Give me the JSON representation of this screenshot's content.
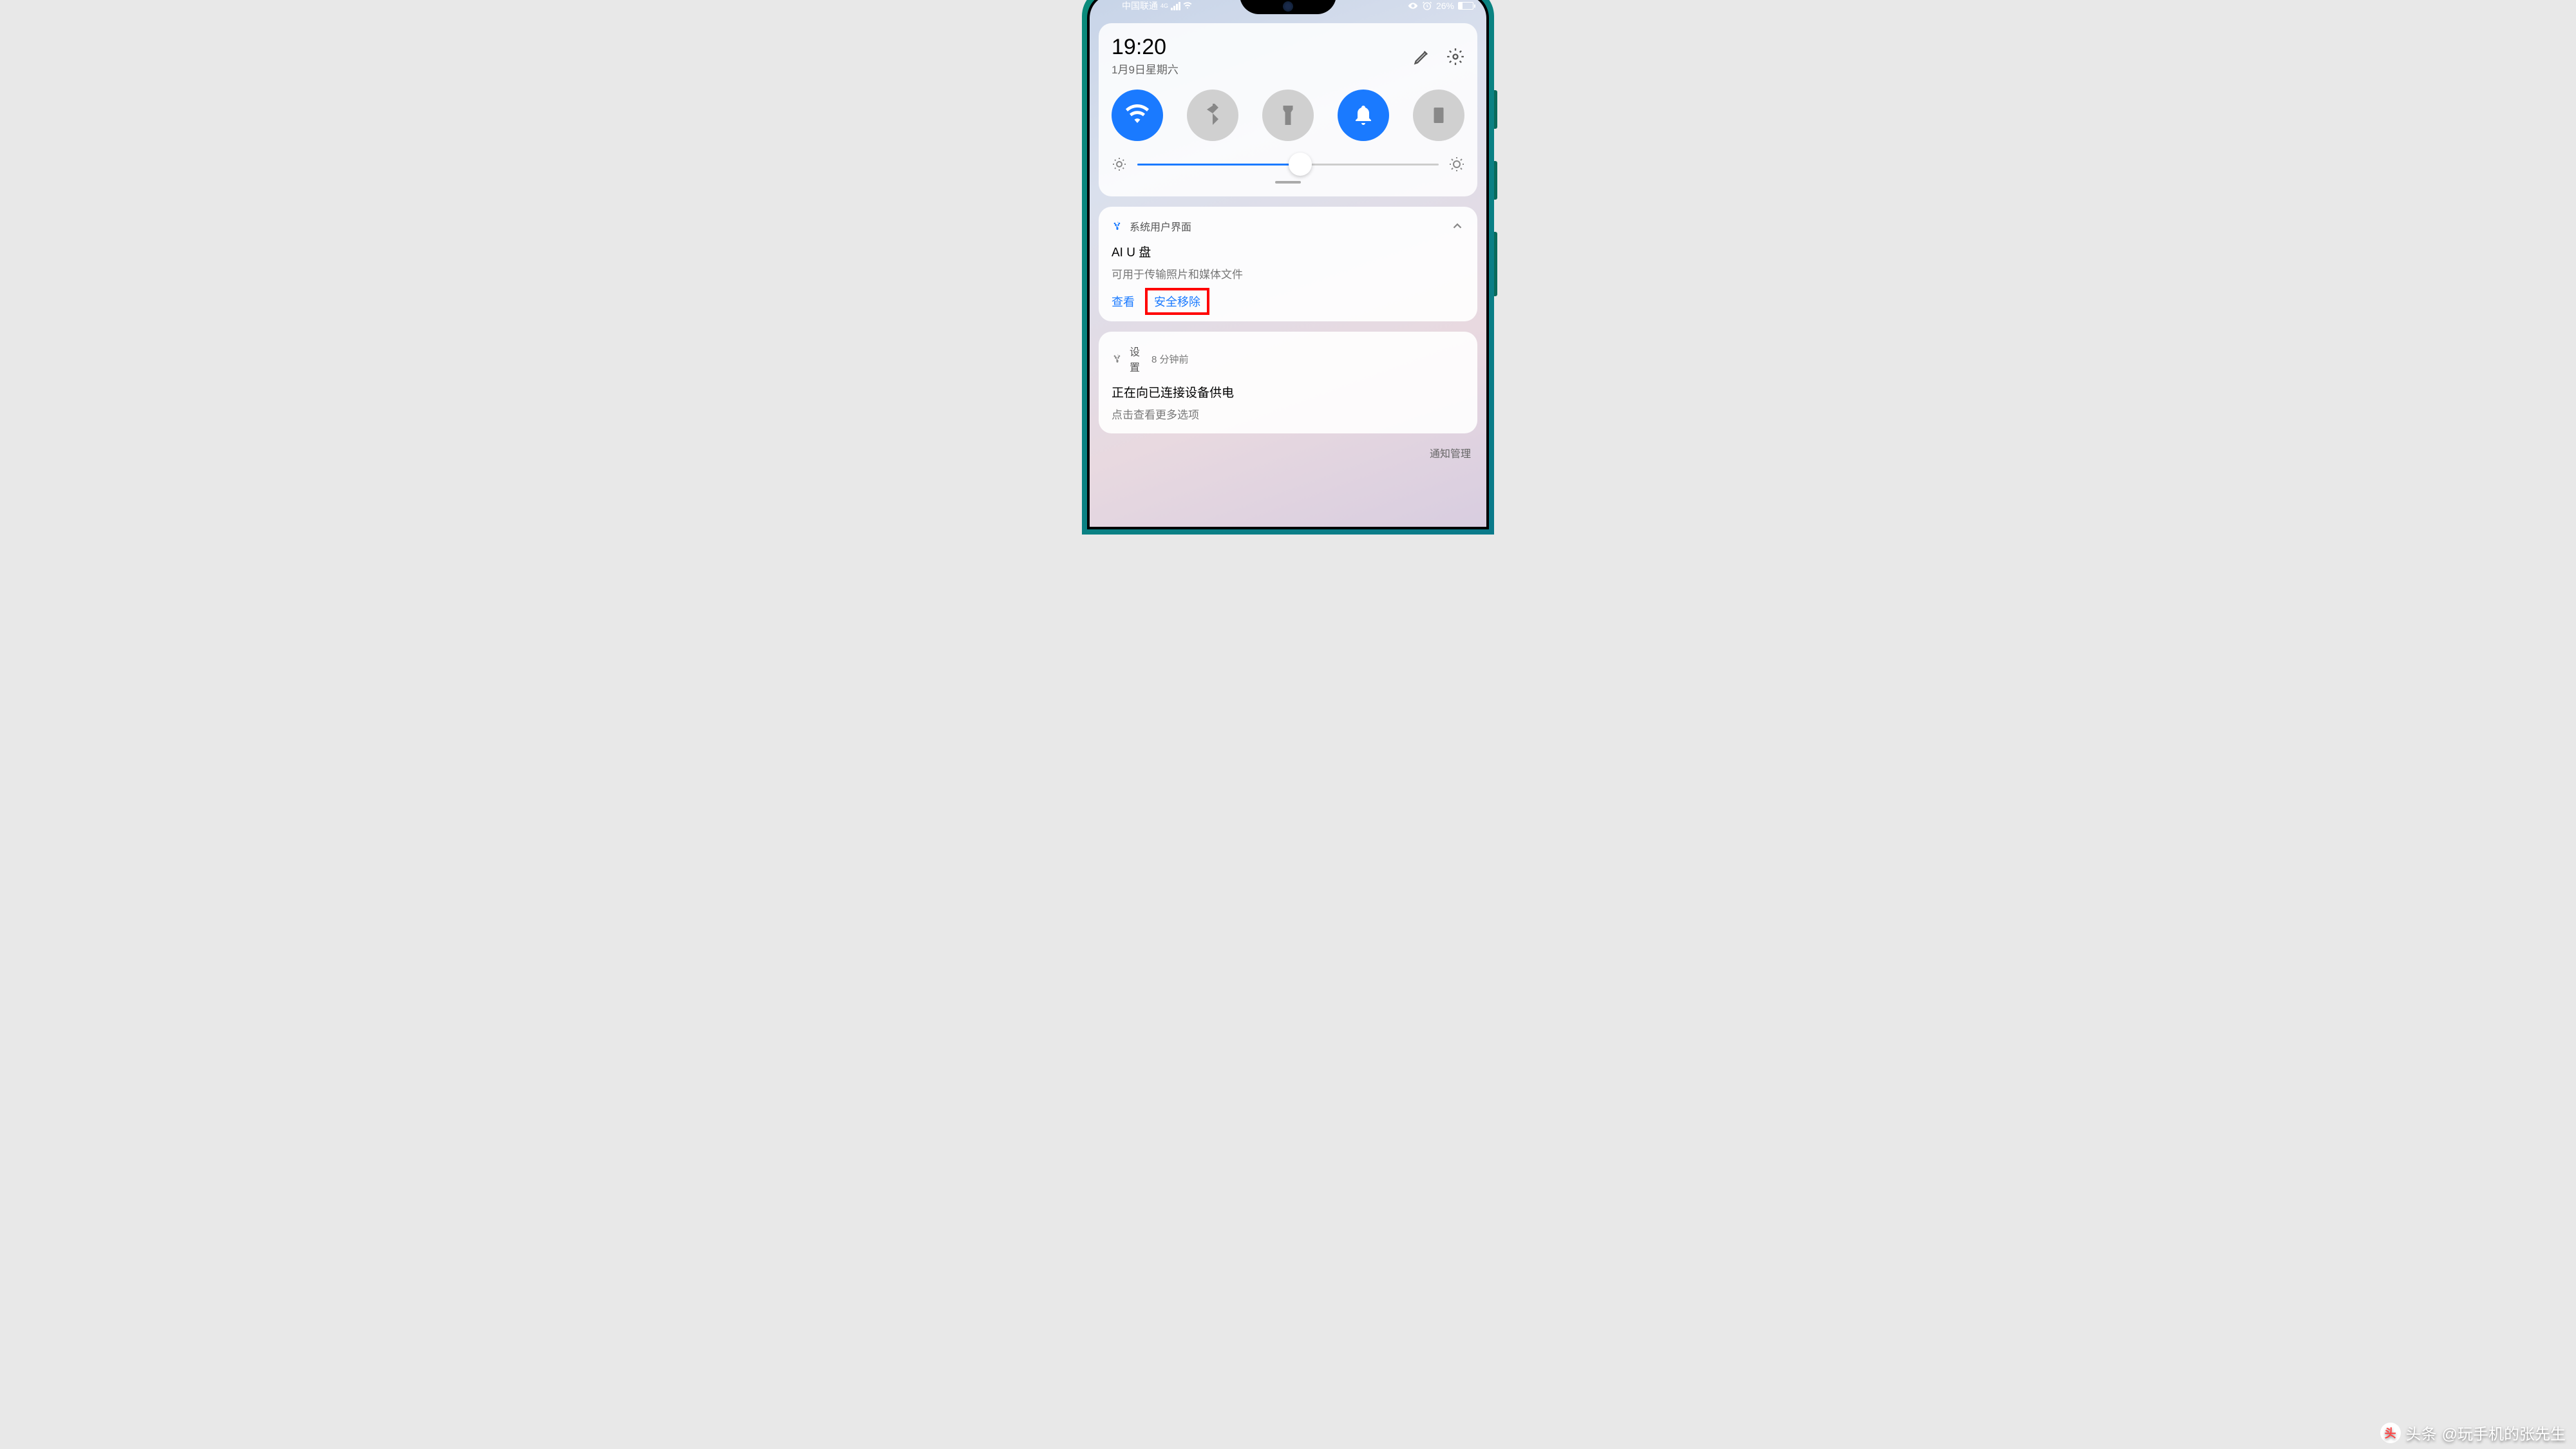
{
  "statusBar": {
    "carrier": "中国联通",
    "network": "4G",
    "batteryPercent": "26%"
  },
  "quickSettings": {
    "time": "19:20",
    "date": "1月9日星期六",
    "toggles": [
      {
        "name": "wifi",
        "active": true
      },
      {
        "name": "bluetooth",
        "active": false
      },
      {
        "name": "flashlight",
        "active": false
      },
      {
        "name": "notification",
        "active": true
      },
      {
        "name": "vibrate",
        "active": false
      }
    ],
    "brightness": 54
  },
  "notifications": [
    {
      "app": "系统用户界面",
      "title": "AI U 盘",
      "body": "可用于传输照片和媒体文件",
      "actions": [
        {
          "label": "查看",
          "highlighted": false
        },
        {
          "label": "安全移除",
          "highlighted": true
        }
      ]
    },
    {
      "app": "设置",
      "time": "8 分钟前",
      "title": "正在向已连接设备供电",
      "body": "点击查看更多选项"
    }
  ],
  "footer": "通知管理",
  "watermark": {
    "brand": "头条",
    "author": "@玩手机的张先生"
  }
}
